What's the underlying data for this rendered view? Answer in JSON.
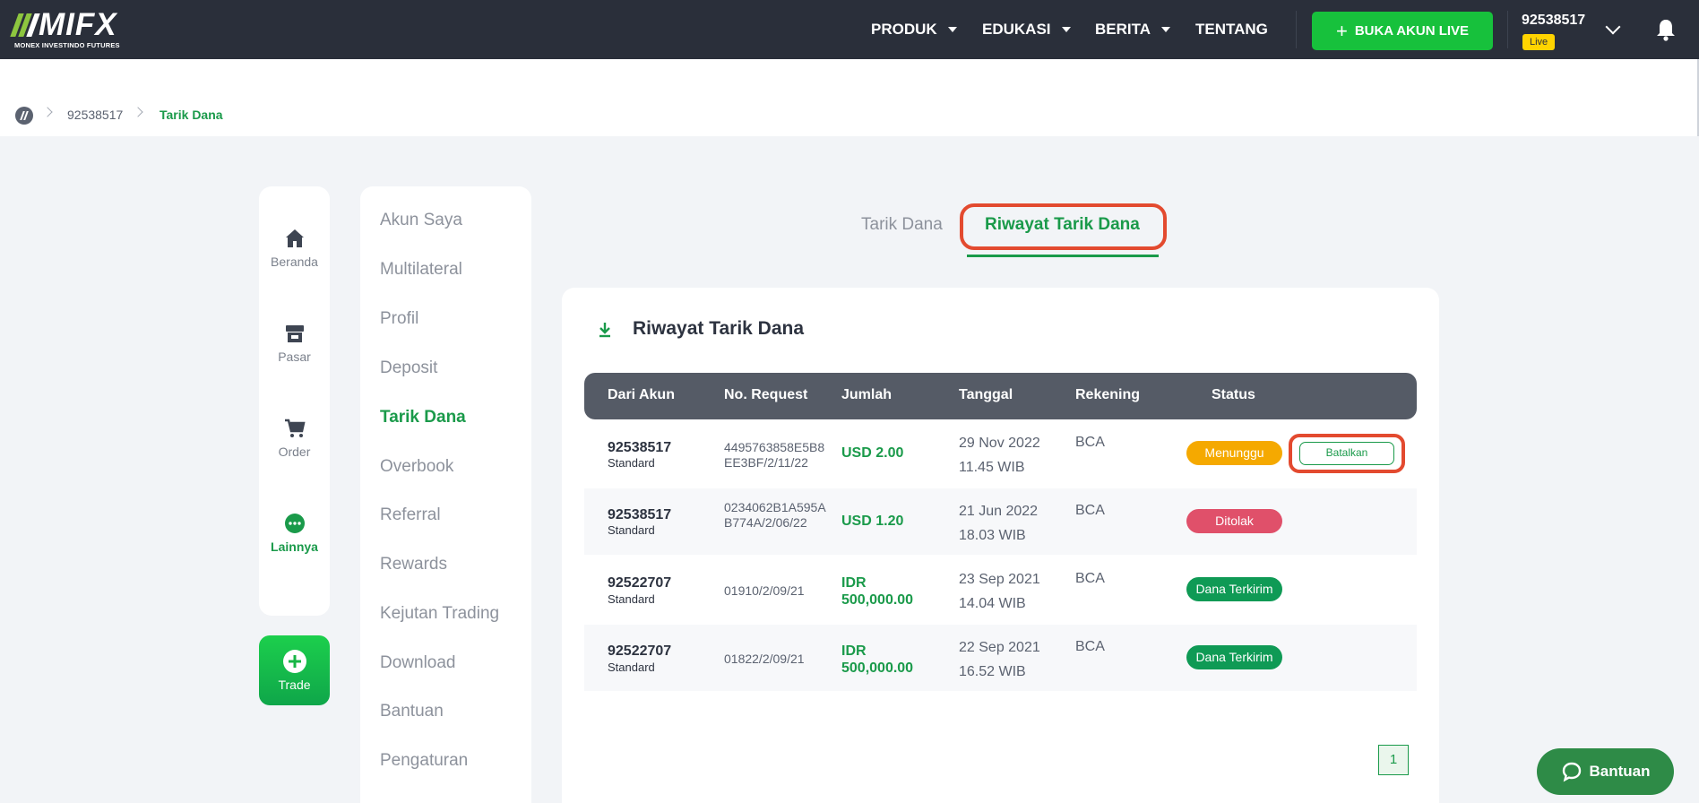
{
  "brand": {
    "name": "MIFX",
    "tagline": "MONEX INVESTINDO FUTURES"
  },
  "nav": {
    "items": [
      {
        "label": "PRODUK",
        "dropdown": true
      },
      {
        "label": "EDUKASI",
        "dropdown": true
      },
      {
        "label": "BERITA",
        "dropdown": true
      },
      {
        "label": "TENTANG",
        "dropdown": false
      }
    ],
    "open_account_label": "BUKA AKUN LIVE",
    "account_number": "92538517",
    "account_badge": "Live"
  },
  "breadcrumb": [
    "92538517",
    "Tarik Dana"
  ],
  "rail": {
    "items": [
      {
        "label": "Beranda",
        "icon": "home-icon"
      },
      {
        "label": "Pasar",
        "icon": "store-icon"
      },
      {
        "label": "Order",
        "icon": "cart-icon"
      },
      {
        "label": "Lainnya",
        "icon": "more-icon",
        "active": true
      }
    ],
    "trade_label": "Trade"
  },
  "menu": {
    "items": [
      "Akun Saya",
      "Multilateral",
      "Profil",
      "Deposit",
      "Tarik Dana",
      "Overbook",
      "Referral",
      "Rewards",
      "Kejutan Trading",
      "Download",
      "Bantuan",
      "Pengaturan"
    ],
    "active": "Tarik Dana"
  },
  "tabs": {
    "inactive": "Tarik Dana",
    "active": "Riwayat Tarik Dana"
  },
  "card": {
    "title": "Riwayat Tarik Dana",
    "columns": [
      "Dari Akun",
      "No. Request",
      "Jumlah",
      "Tanggal",
      "Rekening",
      "Status"
    ],
    "rows": [
      {
        "account": "92538517",
        "type": "Standard",
        "request": "4495763858E5B8EE3BF/2/11/22",
        "amount": "USD 2.00",
        "date": "29 Nov 2022",
        "time": "11.45 WIB",
        "bank": "BCA",
        "status": "Menunggu",
        "action": "Batalkan"
      },
      {
        "account": "92538517",
        "type": "Standard",
        "request": "0234062B1A595AB774A/2/06/22",
        "amount": "USD 1.20",
        "date": "21 Jun 2022",
        "time": "18.03 WIB",
        "bank": "BCA",
        "status": "Ditolak"
      },
      {
        "account": "92522707",
        "type": "Standard",
        "request": "01910/2/09/21",
        "amount": "IDR 500,000.00",
        "date": "23 Sep 2021",
        "time": "14.04 WIB",
        "bank": "BCA",
        "status": "Dana Terkirim"
      },
      {
        "account": "92522707",
        "type": "Standard",
        "request": "01822/2/09/21",
        "amount": "IDR 500,000.00",
        "date": "22 Sep 2021",
        "time": "16.52 WIB",
        "bank": "BCA",
        "status": "Dana Terkirim"
      }
    ],
    "page": "1"
  },
  "help_label": "Bantuan",
  "colors": {
    "topbar": "#2a2f3a",
    "accent": "#1a9a4a",
    "live_button": "#17c13c",
    "highlight": "#e34a2f"
  }
}
